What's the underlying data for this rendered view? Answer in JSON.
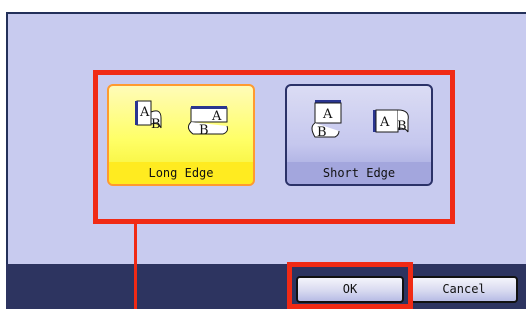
{
  "binding_options": [
    {
      "label": "Long Edge",
      "selected": true
    },
    {
      "label": "Short Edge",
      "selected": false
    }
  ],
  "page_letters": {
    "a": "A",
    "b": "B"
  },
  "buttons": {
    "ok_label": "OK",
    "cancel_label": "Cancel"
  },
  "colors": {
    "panel_background": "#c8cbef",
    "bottom_bar": "#2d3460",
    "selected_option": "#ffeb20",
    "callout_highlight": "#f02a15"
  }
}
